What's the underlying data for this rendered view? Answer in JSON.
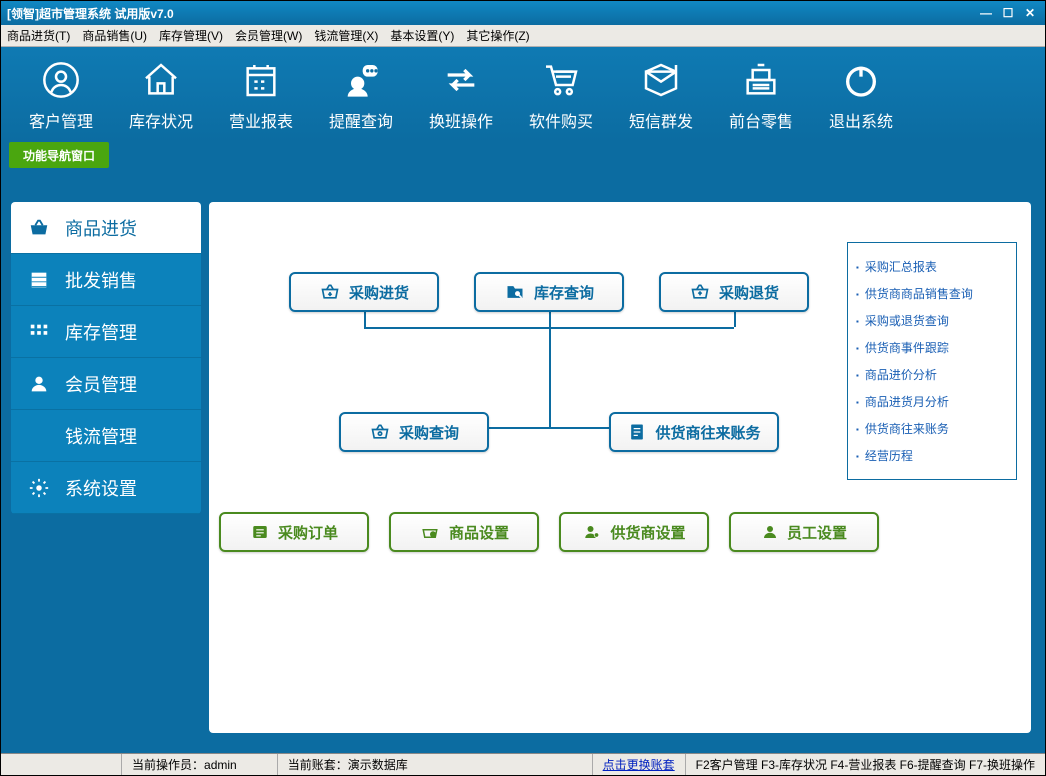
{
  "title": "[领智]超市管理系统 试用版v7.0",
  "menu": [
    "商品进货(T)",
    "商品销售(U)",
    "库存管理(V)",
    "会员管理(W)",
    "钱流管理(X)",
    "基本设置(Y)",
    "其它操作(Z)"
  ],
  "toolbar": [
    {
      "label": "客户管理",
      "name": "customer-mgmt"
    },
    {
      "label": "库存状况",
      "name": "inventory-status"
    },
    {
      "label": "营业报表",
      "name": "business-report"
    },
    {
      "label": "提醒查询",
      "name": "reminder-query"
    },
    {
      "label": "换班操作",
      "name": "shift-change"
    },
    {
      "label": "软件购买",
      "name": "purchase-software"
    },
    {
      "label": "短信群发",
      "name": "sms-bulk"
    },
    {
      "label": "前台零售",
      "name": "front-retail"
    },
    {
      "label": "退出系统",
      "name": "exit-system"
    }
  ],
  "greentab": "功能导航窗口",
  "sidebar": [
    {
      "label": "商品进货",
      "name": "goods-purchase",
      "active": true
    },
    {
      "label": "批发销售",
      "name": "wholesale"
    },
    {
      "label": "库存管理",
      "name": "stock-mgmt"
    },
    {
      "label": "会员管理",
      "name": "member-mgmt"
    },
    {
      "label": "钱流管理",
      "name": "cash-flow"
    },
    {
      "label": "系统设置",
      "name": "system-settings"
    }
  ],
  "flow": {
    "r1": [
      {
        "label": "采购进货"
      },
      {
        "label": "库存查询"
      },
      {
        "label": "采购退货"
      }
    ],
    "r2": [
      {
        "label": "采购查询"
      },
      {
        "label": "供货商往来账务"
      }
    ],
    "r3": [
      {
        "label": "采购订单"
      },
      {
        "label": "商品设置"
      },
      {
        "label": "供货商设置"
      },
      {
        "label": "员工设置"
      }
    ]
  },
  "links": [
    "采购汇总报表",
    "供货商商品销售查询",
    "采购或退货查询",
    "供货商事件跟踪",
    "商品进价分析",
    "商品进货月分析",
    "供货商往来账务",
    "经营历程"
  ],
  "status": {
    "operator_label": "当前操作员：",
    "operator": "admin",
    "dataset_label": "当前账套：",
    "dataset": "演示数据库",
    "switch": "点击更换账套",
    "hotkeys": "F2客户管理 F3-库存状况 F4-营业报表 F6-提醒查询 F7-换班操作"
  }
}
